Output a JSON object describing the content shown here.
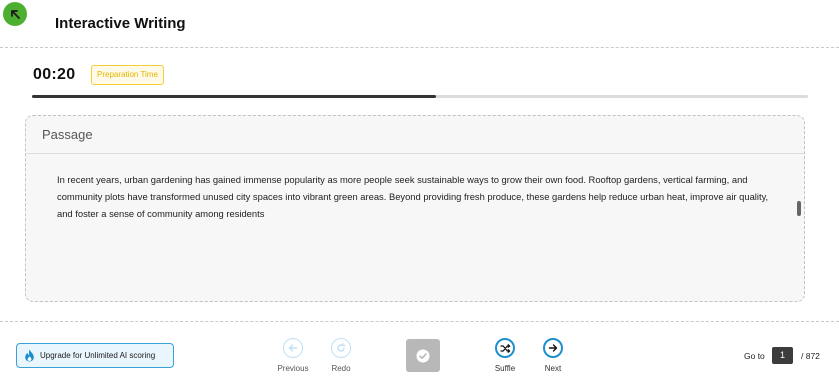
{
  "header": {
    "back_icon": "arrow-up-left-icon",
    "title": "Interactive Writing"
  },
  "timer": {
    "value": "00:20",
    "badge": "Preparation Time",
    "progress": 0.52
  },
  "passage": {
    "heading": "Passage",
    "text": "In recent years, urban gardening has gained immense popularity as more people seek sustainable ways to grow their own food. Rooftop gardens, vertical farming, and community plots have transformed unused city spaces into vibrant green areas. Beyond providing fresh produce, these gardens help reduce urban heat, improve air quality, and foster a sense of community among residents"
  },
  "footer": {
    "upgrade_label": "Upgrade for Unlimited AI scoring",
    "previous_label": "Previous",
    "redo_label": "Redo",
    "shuffle_label": "Suffle",
    "next_label": "Next",
    "goto_label": "Go to",
    "current_page": "1",
    "total_pages": "/ 872"
  },
  "colors": {
    "accent_green": "#4caf2f",
    "accent_blue": "#1d8fcf",
    "badge_yellow": "#f2cf35"
  }
}
